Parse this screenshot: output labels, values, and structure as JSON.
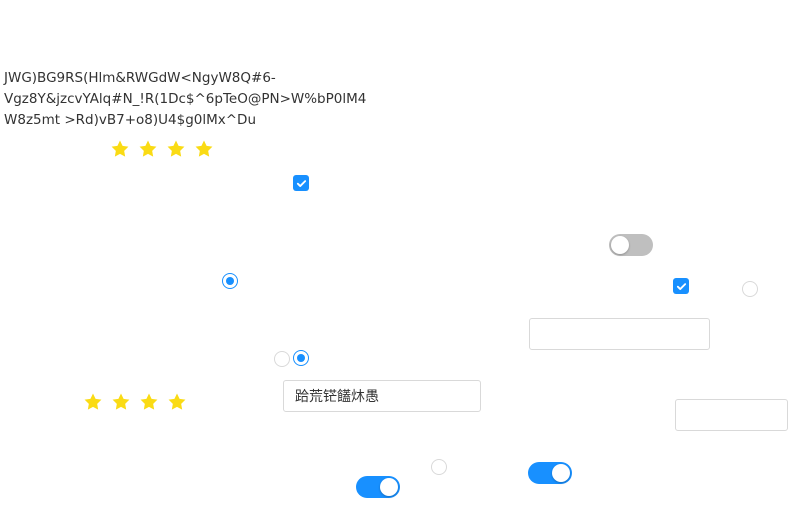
{
  "text_block": {
    "lines": [
      "JWG)BG9RS(Hlm&RWGdW<NgyW8Q#6-",
      "Vgz8Y&jzcvYAlq#N_!R(1Dc$^6pTeO@PN>W%bP0lM4",
      "W8z5mt  >Rd)vB7+o8)U4$g0lMx^Du"
    ]
  },
  "ratings": [
    {
      "value": 4,
      "max": 4
    },
    {
      "value": 4,
      "max": 4
    }
  ],
  "checkboxes": [
    {
      "checked": true
    },
    {
      "checked": true
    }
  ],
  "radios": [
    {
      "checked": true
    },
    {
      "checked": false
    },
    {
      "checked": false
    },
    {
      "checked": true
    },
    {
      "checked": false
    }
  ],
  "switches": [
    {
      "on": false
    },
    {
      "on": true
    },
    {
      "on": true
    }
  ],
  "inputs": [
    {
      "value": ""
    },
    {
      "value": "跲荒铓饚炑愚"
    },
    {
      "value": ""
    }
  ],
  "colors": {
    "primary": "#1890ff",
    "star": "#fadb14",
    "switch_off": "#bfbfbf",
    "border": "#d9d9d9",
    "text": "#333333"
  }
}
